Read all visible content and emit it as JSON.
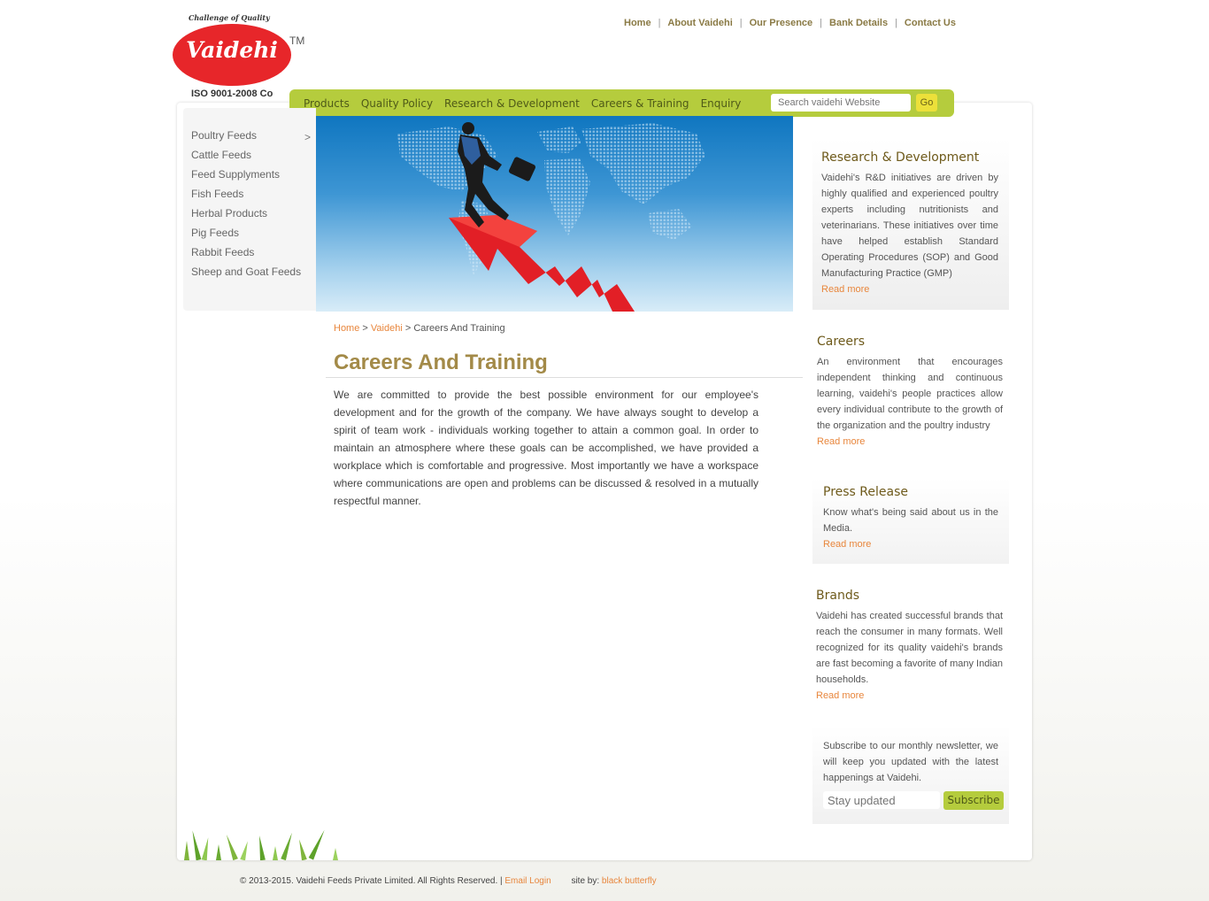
{
  "logo": {
    "tagline": "Challenge of Quality",
    "brand": "Vaidehi",
    "trademark": "TM",
    "iso": "ISO 9001-2008 Co"
  },
  "top_nav": {
    "items": [
      "Home",
      "About Vaidehi",
      "Our Presence",
      "Bank Details",
      "Contact Us"
    ],
    "separator": "|"
  },
  "menu": {
    "items": [
      "Products",
      "Quality Policy",
      "Research & Development",
      "Careers & Training",
      "Enquiry"
    ],
    "search_placeholder": "Search vaidehi Website",
    "go_label": "Go"
  },
  "sidebar": {
    "items": [
      "Poultry Feeds",
      "Cattle Feeds",
      "Feed Supplyments",
      "Fish Feeds",
      "Herbal Products",
      "Pig Feeds",
      "Rabbit Feeds",
      "Sheep and Goat Feeds"
    ],
    "arrow": ">"
  },
  "breadcrumb": {
    "home": "Home",
    "sep1": " > ",
    "section": "Vaidehi",
    "sep2": " > ",
    "current": "Careers And Training"
  },
  "page": {
    "title": "Careers And Training",
    "body": "We are committed to provide the best possible environment for our employee's development and for the growth of the company. We have always sought to develop a spirit of team work - individuals working together to attain a common goal. In order to maintain an atmosphere where these goals can be accomplished, we have provided a workplace which is comfortable and progressive. Most importantly we have a workspace where communications are open and problems can be discussed & resolved in a mutually respectful manner."
  },
  "right": {
    "rd": {
      "title": "Research & Development",
      "text": "Vaidehi's R&D initiatives are driven by highly qualified and experienced poultry experts including nutritionists and veterinarians. These initiatives over time have helped establish Standard Operating Procedures (SOP) and Good Manufacturing Practice (GMP)",
      "more": "Read more"
    },
    "careers": {
      "title": "Careers",
      "text": "An environment that encourages independent thinking and continuous learning, vaidehi's people practices allow every individual contribute to the growth of the organization and the poultry industry",
      "more": "Read more"
    },
    "press": {
      "title": "Press Release",
      "text": "Know what's being said about us in the Media.",
      "more": "Read more"
    },
    "brands": {
      "title": "Brands",
      "text": "Vaidehi has created successful brands that reach the consumer in many formats. Well recognized for its quality vaidehi's brands are fast becoming a favorite of many Indian households.",
      "more": "Read more"
    },
    "subscribe": {
      "text": "Subscribe to our monthly newsletter, we will keep you updated with the latest happenings at Vaidehi.",
      "placeholder": "Stay updated",
      "button": "Subscribe"
    }
  },
  "footer": {
    "copyright": "© 2013-2015. Vaidehi Feeds Private Limited. All Rights Reserved. |",
    "email_login": "Email Login",
    "site_by": "site by:",
    "designer": "black butterfly"
  },
  "colors": {
    "brand_red": "#e7262a",
    "menu_green": "#b5cc3d",
    "title_gold": "#a38a48",
    "link_orange": "#e8863c",
    "nav_brown": "#8a7a45",
    "go_yellow": "#ece03a"
  },
  "icons": {
    "banner": "businessman-climbing-arrow-graphic",
    "grass": "grass-decoration"
  }
}
